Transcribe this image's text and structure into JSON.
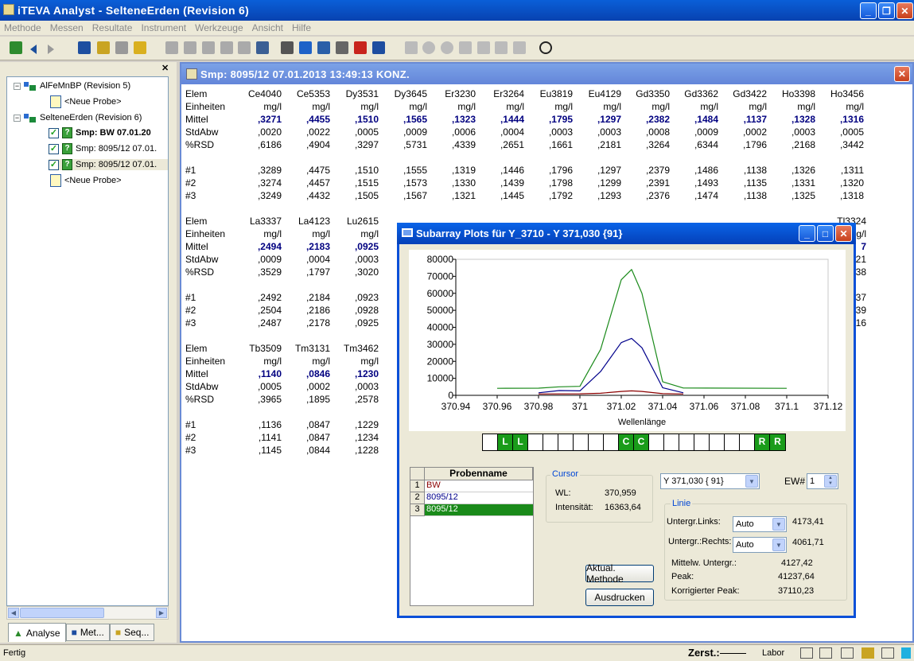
{
  "window": {
    "title": "iTEVA  Analyst - SelteneErden (Revision 6)"
  },
  "menu": [
    "Methode",
    "Messen",
    "Resultate",
    "Instrument",
    "Werkzeuge",
    "Ansicht",
    "Hilfe"
  ],
  "tree": {
    "items": [
      {
        "label": "AlFeMnBP (Revision 5)"
      },
      {
        "label": "<Neue Probe>"
      },
      {
        "label": "SelteneErden (Revision 6)"
      },
      {
        "label": "Smp: BW   07.01.20"
      },
      {
        "label": "Smp: 8095/12   07.01."
      },
      {
        "label": "Smp: 8095/12   07.01."
      },
      {
        "label": "<Neue Probe>"
      }
    ]
  },
  "tabs": [
    {
      "label": "Analyse"
    },
    {
      "label": "Met..."
    },
    {
      "label": "Seq..."
    }
  ],
  "doc": {
    "title": "Smp: 8095/12   07.01.2013 13:49:13   KONZ.",
    "row_labels": [
      "Elem",
      "Einheiten",
      "Mittel",
      "StdAbw",
      "%RSD",
      "#1",
      "#2",
      "#3"
    ],
    "block1": {
      "elems": [
        "Ce4040",
        "Ce5353",
        "Dy3531",
        "Dy3645",
        "Er3230",
        "Er3264",
        "Eu3819",
        "Eu4129",
        "Gd3350",
        "Gd3362",
        "Gd3422",
        "Ho3398",
        "Ho3456"
      ],
      "units": [
        "mg/l",
        "mg/l",
        "mg/l",
        "mg/l",
        "mg/l",
        "mg/l",
        "mg/l",
        "mg/l",
        "mg/l",
        "mg/l",
        "mg/l",
        "mg/l",
        "mg/l"
      ],
      "mittel": [
        ",3271",
        ",4455",
        ",1510",
        ",1565",
        ",1323",
        ",1444",
        ",1795",
        ",1297",
        ",2382",
        ",1484",
        ",1137",
        ",1328",
        ",1316"
      ],
      "stdabw": [
        ",0020",
        ",0022",
        ",0005",
        ",0009",
        ",0006",
        ",0004",
        ",0003",
        ",0003",
        ",0008",
        ",0009",
        ",0002",
        ",0003",
        ",0005"
      ],
      "rsd": [
        ",6186",
        ",4904",
        ",3297",
        ",5731",
        ",4339",
        ",2651",
        ",1661",
        ",2181",
        ",3264",
        ",6344",
        ",1796",
        ",2168",
        ",3442"
      ],
      "r1": [
        ",3289",
        ",4475",
        ",1510",
        ",1555",
        ",1319",
        ",1446",
        ",1796",
        ",1297",
        ",2379",
        ",1486",
        ",1138",
        ",1326",
        ",1311"
      ],
      "r2": [
        ",3274",
        ",4457",
        ",1515",
        ",1573",
        ",1330",
        ",1439",
        ",1798",
        ",1299",
        ",2391",
        ",1493",
        ",1135",
        ",1331",
        ",1320"
      ],
      "r3": [
        ",3249",
        ",4432",
        ",1505",
        ",1567",
        ",1321",
        ",1445",
        ",1792",
        ",1293",
        ",2376",
        ",1474",
        ",1138",
        ",1325",
        ",1318"
      ]
    },
    "block2": {
      "elems": [
        "La3337",
        "La4123",
        "Lu2615"
      ],
      "units": [
        "mg/l",
        "mg/l",
        "mg/l"
      ],
      "mittel": [
        ",2494",
        ",2183",
        ",0925"
      ],
      "stdabw": [
        ",0009",
        ",0004",
        ",0003"
      ],
      "rsd": [
        ",3529",
        ",1797",
        ",3020"
      ],
      "r1": [
        ",2492",
        ",2184",
        ",0923"
      ],
      "r2": [
        ",2504",
        ",2186",
        ",0928"
      ],
      "r3": [
        ",2487",
        ",2178",
        ",0925"
      ],
      "right_edge": [
        "Tl3324",
        "mg/l",
        "7",
        "21",
        "38",
        "37",
        "39",
        "16"
      ]
    },
    "block3": {
      "elems": [
        "Tb3509",
        "Tm3131",
        "Tm3462"
      ],
      "units": [
        "mg/l",
        "mg/l",
        "mg/l"
      ],
      "mittel": [
        ",1140",
        ",0846",
        ",1230"
      ],
      "stdabw": [
        ",0005",
        ",0002",
        ",0003"
      ],
      "rsd": [
        ",3965",
        ",1895",
        ",2578"
      ],
      "r1": [
        ",1136",
        ",0847",
        ",1229"
      ],
      "r2": [
        ",1141",
        ",0847",
        ",1234"
      ],
      "r3": [
        ",1145",
        ",0844",
        ",1228"
      ]
    }
  },
  "dialog": {
    "title": "Subarray Plots für Y_3710 - Y 371,030 {91}",
    "probenname_header": "Probenname",
    "samples": [
      {
        "n": "1",
        "name": "BW"
      },
      {
        "n": "2",
        "name": "8095/12"
      },
      {
        "n": "3",
        "name": "8095/12"
      }
    ],
    "cursor": {
      "label": "Cursor",
      "wl_label": "WL:",
      "wl": "370,959",
      "int_label": "Intensität:",
      "int": "16363,64"
    },
    "line_select": "Y 371,030 { 91}",
    "ew_label": "EW#",
    "ew": "1",
    "linie": {
      "label": "Linie",
      "links_label": "Untergr.Links:",
      "links_mode": "Auto",
      "links_val": "4173,41",
      "rechts_label": "Untergr.:Rechts:",
      "rechts_mode": "Auto",
      "rechts_val": "4061,71",
      "mittelw_label": "Mittelw. Untergr.:",
      "mittelw": "4127,42",
      "peak_label": "Peak:",
      "peak": "41237,64",
      "korr_label": "Korrigierter Peak:",
      "korr": "37110,23"
    },
    "btn_aktual": "Aktual. Methode",
    "btn_druck": "Ausdrucken",
    "lr_cells": [
      "",
      "L",
      "L",
      "",
      "",
      "",
      "",
      "",
      "",
      "C",
      "C",
      "",
      "",
      "",
      "",
      "",
      "",
      "",
      "R",
      "R"
    ]
  },
  "chart_data": {
    "type": "line",
    "xlabel": "Wellenlänge",
    "xlim": [
      370.94,
      371.12
    ],
    "ylim": [
      0,
      80000
    ],
    "xticks": [
      "370.94",
      "370.96",
      "370.98",
      "371",
      "371.02",
      "371.04",
      "371.06",
      "371.08",
      "371.1",
      "371.12"
    ],
    "yticks": [
      "0",
      "10000",
      "20000",
      "30000",
      "40000",
      "50000",
      "60000",
      "70000",
      "80000"
    ],
    "series": [
      {
        "color": "#1a8a1a",
        "x": [
          370.96,
          370.98,
          370.99,
          371.0,
          371.01,
          371.02,
          371.025,
          371.03,
          371.04,
          371.05,
          371.1
        ],
        "y": [
          4100,
          4200,
          5000,
          5300,
          27000,
          68000,
          74000,
          60000,
          8000,
          4300,
          4100
        ]
      },
      {
        "color": "#00008b",
        "x": [
          370.98,
          370.99,
          371.0,
          371.01,
          371.02,
          371.025,
          371.03,
          371.04,
          371.05
        ],
        "y": [
          1500,
          2800,
          2600,
          14000,
          31000,
          33500,
          28000,
          4500,
          1500
        ]
      },
      {
        "color": "#8b0000",
        "x": [
          370.98,
          371.0,
          371.01,
          371.02,
          371.025,
          371.03,
          371.04,
          371.05
        ],
        "y": [
          800,
          900,
          1200,
          2300,
          2600,
          2300,
          1000,
          800
        ]
      }
    ]
  },
  "status": {
    "left": "Fertig",
    "zerst": "Zerst.:",
    "labor": "Labor"
  }
}
